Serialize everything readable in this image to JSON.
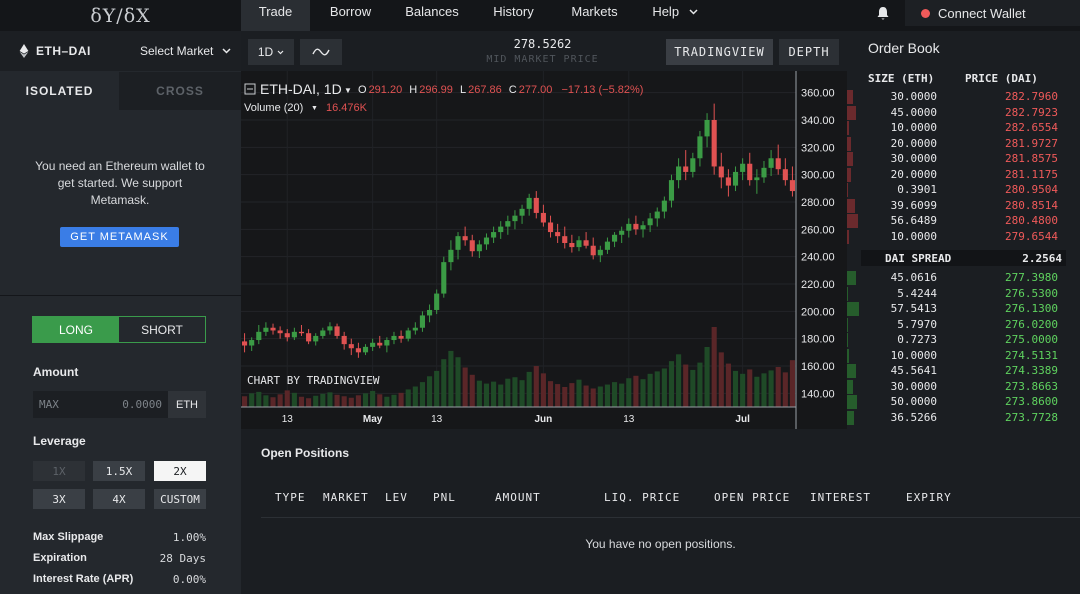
{
  "logo": "δY/δX",
  "nav": {
    "items": [
      {
        "label": "Trade",
        "active": true
      },
      {
        "label": "Borrow"
      },
      {
        "label": "Balances"
      },
      {
        "label": "History"
      },
      {
        "label": "Markets"
      },
      {
        "label": "Help"
      }
    ],
    "connect_label": "Connect Wallet",
    "status_color": "#f05a5a"
  },
  "left": {
    "pair": "ETH–DAI",
    "select_market": "Select Market",
    "tabs": {
      "isolated": "ISOLATED",
      "cross": "CROSS"
    },
    "wallet_message": "You need an Ethereum wallet to get started. We support Metamask.",
    "metamask_button": "GET METAMASK",
    "long": "LONG",
    "short": "SHORT",
    "amount_label": "Amount",
    "amount_placeholder": "MAX",
    "amount_value": "0.0000",
    "amount_unit": "ETH",
    "leverage_label": "Leverage",
    "leverage_options": [
      "1X",
      "1.5X",
      "2X",
      "3X",
      "4X",
      "CUSTOM"
    ],
    "leverage_selected": "2X",
    "max_slippage_label": "Max Slippage",
    "max_slippage": "1.00%",
    "expiration_label": "Expiration",
    "expiration": "28 Days",
    "interest_label": "Interest Rate (APR)",
    "interest": "0.00%"
  },
  "toolbar": {
    "interval": "1D",
    "mid_price": "278.5262",
    "mid_label": "MID MARKET PRICE",
    "tradingview": "TRADINGVIEW",
    "depth": "DEPTH"
  },
  "chart_data": {
    "type": "candlestick",
    "symbol": "ETH-DAI, 1D",
    "ohlc_label": {
      "o": "291.20",
      "h": "296.99",
      "l": "267.86",
      "c": "277.00",
      "change": "−17.13 (−5.82%)"
    },
    "volume_label": "Volume (20)",
    "volume_value": "16.476K",
    "watermark": "CHART BY TRADINGVIEW",
    "y_ticks": [
      360,
      340,
      320,
      300,
      280,
      260,
      240,
      220,
      200,
      180,
      160,
      140
    ],
    "y_tick_labels": [
      "360.00",
      "340.00",
      "320.00",
      "300.00",
      "280.00",
      "260.00",
      "240.00",
      "220.00",
      "200.00",
      "180.00",
      "160.00",
      "140.00"
    ],
    "ylim": [
      130,
      370
    ],
    "x_ticks": [
      {
        "label": "13",
        "index": 6
      },
      {
        "label": "May",
        "index": 18
      },
      {
        "label": "13",
        "index": 27
      },
      {
        "label": "Jun",
        "index": 42
      },
      {
        "label": "13",
        "index": 54
      },
      {
        "label": "Jul",
        "index": 70
      }
    ],
    "up_color": "#3b9b45",
    "down_color": "#e05252",
    "candles": [
      [
        178,
        184,
        170,
        175
      ],
      [
        175,
        181,
        171,
        179
      ],
      [
        179,
        190,
        176,
        185
      ],
      [
        185,
        192,
        182,
        188
      ],
      [
        188,
        191,
        183,
        186
      ],
      [
        186,
        189,
        180,
        184
      ],
      [
        184,
        187,
        178,
        181
      ],
      [
        181,
        188,
        179,
        185
      ],
      [
        185,
        190,
        182,
        184
      ],
      [
        184,
        187,
        176,
        178
      ],
      [
        178,
        184,
        175,
        182
      ],
      [
        182,
        188,
        180,
        186
      ],
      [
        186,
        192,
        183,
        189
      ],
      [
        189,
        191,
        180,
        182
      ],
      [
        182,
        185,
        172,
        176
      ],
      [
        176,
        180,
        168,
        173
      ],
      [
        173,
        177,
        166,
        170
      ],
      [
        170,
        176,
        168,
        174
      ],
      [
        174,
        180,
        171,
        177
      ],
      [
        177,
        182,
        173,
        175
      ],
      [
        175,
        181,
        170,
        179
      ],
      [
        179,
        185,
        176,
        182
      ],
      [
        182,
        186,
        177,
        180
      ],
      [
        180,
        188,
        178,
        186
      ],
      [
        186,
        192,
        183,
        188
      ],
      [
        188,
        200,
        185,
        197
      ],
      [
        197,
        205,
        192,
        201
      ],
      [
        201,
        216,
        198,
        213
      ],
      [
        213,
        240,
        210,
        236
      ],
      [
        236,
        252,
        230,
        245
      ],
      [
        245,
        258,
        238,
        255
      ],
      [
        255,
        262,
        248,
        252
      ],
      [
        252,
        256,
        240,
        244
      ],
      [
        244,
        252,
        239,
        249
      ],
      [
        249,
        257,
        245,
        254
      ],
      [
        254,
        262,
        250,
        258
      ],
      [
        258,
        266,
        253,
        262
      ],
      [
        262,
        270,
        256,
        266
      ],
      [
        266,
        274,
        260,
        270
      ],
      [
        270,
        278,
        264,
        275
      ],
      [
        275,
        286,
        270,
        283
      ],
      [
        283,
        288,
        268,
        272
      ],
      [
        272,
        278,
        262,
        265
      ],
      [
        265,
        270,
        254,
        258
      ],
      [
        258,
        264,
        250,
        255
      ],
      [
        255,
        262,
        246,
        250
      ],
      [
        250,
        256,
        243,
        247
      ],
      [
        247,
        255,
        244,
        252
      ],
      [
        252,
        258,
        246,
        248
      ],
      [
        248,
        254,
        238,
        241
      ],
      [
        241,
        248,
        236,
        245
      ],
      [
        245,
        254,
        242,
        251
      ],
      [
        251,
        258,
        247,
        256
      ],
      [
        256,
        262,
        250,
        259
      ],
      [
        259,
        268,
        254,
        264
      ],
      [
        264,
        270,
        256,
        260
      ],
      [
        260,
        266,
        254,
        263
      ],
      [
        263,
        272,
        258,
        268
      ],
      [
        268,
        276,
        262,
        273
      ],
      [
        273,
        284,
        268,
        281
      ],
      [
        281,
        300,
        276,
        296
      ],
      [
        296,
        312,
        290,
        306
      ],
      [
        306,
        318,
        296,
        302
      ],
      [
        302,
        316,
        298,
        312
      ],
      [
        312,
        332,
        306,
        328
      ],
      [
        328,
        345,
        320,
        340
      ],
      [
        340,
        352,
        300,
        306
      ],
      [
        306,
        316,
        290,
        298
      ],
      [
        298,
        304,
        284,
        292
      ],
      [
        292,
        306,
        288,
        302
      ],
      [
        302,
        312,
        296,
        308
      ],
      [
        308,
        316,
        292,
        296
      ],
      [
        296,
        304,
        286,
        298
      ],
      [
        298,
        310,
        294,
        305
      ],
      [
        305,
        318,
        299,
        312
      ],
      [
        312,
        322,
        300,
        304
      ],
      [
        304,
        312,
        292,
        296
      ],
      [
        296,
        306,
        284,
        288
      ]
    ],
    "volumes": [
      2.2,
      2.8,
      3.1,
      2.4,
      2.0,
      2.6,
      3.4,
      2.9,
      2.1,
      1.8,
      2.3,
      2.7,
      3.0,
      2.5,
      2.2,
      1.9,
      2.4,
      2.8,
      3.3,
      2.6,
      2.1,
      2.5,
      2.9,
      3.6,
      4.2,
      5.1,
      6.3,
      7.4,
      9.8,
      11.5,
      10.2,
      8.1,
      6.6,
      5.4,
      4.8,
      5.2,
      4.6,
      5.8,
      6.1,
      5.5,
      7.2,
      8.4,
      6.9,
      5.3,
      4.7,
      4.1,
      4.9,
      5.6,
      4.4,
      3.8,
      4.2,
      4.6,
      5.1,
      4.8,
      5.9,
      6.4,
      5.7,
      6.8,
      7.3,
      7.9,
      9.4,
      10.8,
      8.7,
      7.6,
      9.1,
      12.3,
      16.4,
      11.2,
      8.9,
      7.4,
      6.8,
      7.7,
      6.2,
      6.9,
      7.5,
      8.2,
      7.1,
      9.6
    ]
  },
  "orderbook": {
    "title": "Order Book",
    "size_header": "SIZE (ETH)",
    "price_header": "PRICE (DAI)",
    "asks": [
      {
        "size": "30.0000",
        "price": "282.7960",
        "depth": 0.3
      },
      {
        "size": "45.0000",
        "price": "282.7923",
        "depth": 0.45
      },
      {
        "size": "10.0000",
        "price": "282.6554",
        "depth": 0.1
      },
      {
        "size": "20.0000",
        "price": "281.9727",
        "depth": 0.2
      },
      {
        "size": "30.0000",
        "price": "281.8575",
        "depth": 0.3
      },
      {
        "size": "20.0000",
        "price": "281.1175",
        "depth": 0.2
      },
      {
        "size": "0.3901",
        "price": "280.9504",
        "depth": 0.05
      },
      {
        "size": "39.6099",
        "price": "280.8514",
        "depth": 0.4
      },
      {
        "size": "56.6489",
        "price": "280.4800",
        "depth": 0.57
      },
      {
        "size": "10.0000",
        "price": "279.6544",
        "depth": 0.1
      }
    ],
    "spread_label": "DAI SPREAD",
    "spread": "2.2564",
    "bids": [
      {
        "size": "45.0616",
        "price": "277.3980",
        "depth": 0.45
      },
      {
        "size": "5.4244",
        "price": "276.5300",
        "depth": 0.05
      },
      {
        "size": "57.5413",
        "price": "276.1300",
        "depth": 0.58
      },
      {
        "size": "5.7970",
        "price": "276.0200",
        "depth": 0.06
      },
      {
        "size": "0.7273",
        "price": "275.0000",
        "depth": 0.05
      },
      {
        "size": "10.0000",
        "price": "274.5131",
        "depth": 0.1
      },
      {
        "size": "45.5641",
        "price": "274.3389",
        "depth": 0.46
      },
      {
        "size": "30.0000",
        "price": "273.8663",
        "depth": 0.3
      },
      {
        "size": "50.0000",
        "price": "273.8600",
        "depth": 0.5
      },
      {
        "size": "36.5266",
        "price": "273.7728",
        "depth": 0.37
      }
    ],
    "ask_color": "#f05a5a",
    "bid_color": "#5fd35f"
  },
  "positions": {
    "title": "Open Positions",
    "columns": [
      "TYPE",
      "MARKET",
      "LEV",
      "PNL",
      "AMOUNT",
      "LIQ. PRICE",
      "OPEN PRICE",
      "INTEREST",
      "EXPIRY"
    ],
    "empty": "You have no open positions."
  }
}
